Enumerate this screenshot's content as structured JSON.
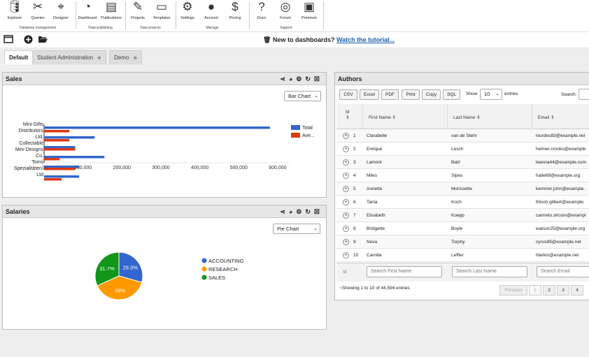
{
  "ribbon": {
    "buttons": [
      {
        "icon": "database-icon",
        "label": "Explorer"
      },
      {
        "icon": "tools-icon",
        "label": "Queries"
      },
      {
        "icon": "compass-icon",
        "label": "Designer"
      },
      {
        "icon": "gauge-icon",
        "label": "Dashboard"
      },
      {
        "icon": "newspaper-icon",
        "label": "Publications"
      },
      {
        "icon": "wand-icon",
        "label": "Projects"
      },
      {
        "icon": "monitor-icon",
        "label": "Templates"
      },
      {
        "icon": "gear-icon",
        "label": "Settings"
      },
      {
        "icon": "user-icon",
        "label": "Account"
      },
      {
        "icon": "pricing-icon",
        "label": "Pricing"
      },
      {
        "icon": "question-icon",
        "label": "Docs"
      },
      {
        "icon": "lifebuoy-icon",
        "label": "Forum"
      },
      {
        "icon": "truck-icon",
        "label": "Premium"
      }
    ],
    "groups": [
      "Database management",
      "Data publishing",
      "Data projects",
      "Manage",
      "Support"
    ]
  },
  "banner": {
    "text": "New to dashboards?",
    "link": "Watch the tutorial..."
  },
  "tabs": [
    {
      "label": "Default",
      "active": true
    },
    {
      "label": "Student Administration",
      "active": false
    },
    {
      "label": "Demo",
      "active": false
    }
  ],
  "sales": {
    "title": "Sales",
    "select": "Bar Chart"
  },
  "chart_data": [
    {
      "type": "bar",
      "orientation": "horizontal",
      "categories": [
        "Mini Gifts Distributors Ltd.",
        "Collectable Mini Designs Co.",
        "Toms Spezialitäten, Ltd"
      ],
      "series": [
        {
          "name": "Total",
          "color": "#3366cc",
          "values": [
            580000,
            130000,
            155000
          ]
        },
        {
          "name": "Ave...",
          "color": "#dc3912",
          "values": [
            65000,
            70000,
            45000
          ]
        }
      ],
      "extra_bars": [
        {
          "series": "Total",
          "value": 80000
        },
        {
          "series": "Total",
          "value": 90000
        },
        {
          "series": "Ave...",
          "value": 40000
        }
      ],
      "xlim": [
        0,
        620000
      ],
      "xticks": [
        "0",
        "100,000",
        "200,000",
        "300,000",
        "400,000",
        "500,000",
        "600,000"
      ],
      "legend": "right"
    },
    {
      "type": "pie",
      "categories": [
        "ACCOUNTING",
        "RESEARCH",
        "SALES"
      ],
      "values": [
        29.3,
        39,
        31.7
      ],
      "labels": [
        "29.3%",
        "39%",
        "31.7%"
      ],
      "colors": [
        "#3366cc",
        "#ff9900",
        "#109618"
      ],
      "legend": "right"
    }
  ],
  "salaries": {
    "title": "Salaries",
    "select": "Pie Chart"
  },
  "authors": {
    "title": "Authors",
    "buttons": [
      "CSV",
      "Excel",
      "PDF",
      "Print",
      "Copy",
      "SQL"
    ],
    "show_label": "Show",
    "show_value": "10",
    "entries_label": "entries",
    "search_label": "Search:",
    "columns": [
      "Id",
      "First Name",
      "Last Name",
      "Email"
    ],
    "rows": [
      {
        "id": "1",
        "first": "Clarabelle",
        "last": "van de Stehr",
        "email": "lourdes83@example.net"
      },
      {
        "id": "2",
        "first": "Enrique",
        "last": "Lesch",
        "email": "helmer.crooks@example"
      },
      {
        "id": "3",
        "first": "Lamont",
        "last": "Batz",
        "email": "leanna44@example.com"
      },
      {
        "id": "4",
        "first": "Miles",
        "last": "Sipes",
        "email": "halle69@example.org"
      },
      {
        "id": "5",
        "first": "Annette",
        "last": "Morissette",
        "email": "kemmer.john@example."
      },
      {
        "id": "6",
        "first": "Tania",
        "last": "Koch",
        "email": "fritsch.gilbert@example."
      },
      {
        "id": "7",
        "first": "Elisabeth",
        "last": "Koepp",
        "email": "carmelo.strosin@exampl"
      },
      {
        "id": "8",
        "first": "Bridgette",
        "last": "Boyle",
        "email": "watson25@example.org"
      },
      {
        "id": "9",
        "first": "Neva",
        "last": "Torphy",
        "email": "cyrus89@example.net"
      },
      {
        "id": "10",
        "first": "Camilla",
        "last": "Leffler",
        "email": "hlarkin@example.net"
      }
    ],
    "search_placeholders": {
      "id": "Id",
      "first": "Search First Name",
      "last": "Search Last Name",
      "email": "Search Email"
    },
    "info": "Showing 1 to 10 of 44,594 entries",
    "pagination": [
      "Previous",
      "1",
      "2",
      "3",
      "4"
    ]
  }
}
